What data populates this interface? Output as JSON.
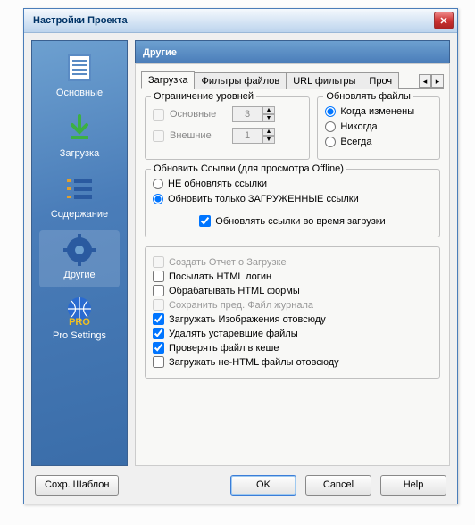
{
  "window": {
    "title": "Настройки Проекта",
    "close": "✕"
  },
  "sidebar": {
    "items": [
      {
        "label": "Основные"
      },
      {
        "label": "Загрузка"
      },
      {
        "label": "Содержание"
      },
      {
        "label": "Другие"
      },
      {
        "label": "Pro Settings"
      }
    ]
  },
  "main": {
    "header": "Другие",
    "tabs": [
      "Загрузка",
      "Фильтры файлов",
      "URL фильтры",
      "Проч"
    ],
    "tab_nav": {
      "prev": "◂",
      "next": "▸"
    }
  },
  "levels": {
    "legend": "Ограничение уровней",
    "row1_label": "Основные",
    "row1_value": "3",
    "row2_label": "Внешние",
    "row2_value": "1"
  },
  "update": {
    "legend": "Обновлять файлы",
    "opt1": "Когда изменены",
    "opt2": "Никогда",
    "opt3": "Всегда"
  },
  "links": {
    "legend": "Обновить Ссылки (для просмотра Offline)",
    "opt1": "НЕ обновлять ссылки",
    "opt2": "Обновить только ЗАГРУЖЕННЫЕ ссылки",
    "cb": "Обновлять ссылки во время загрузки"
  },
  "opts": {
    "o1": "Создать Отчет о Загрузке",
    "o2": "Посылать HTML логин",
    "o3": "Обрабатывать HTML формы",
    "o4": "Сохранить пред. Файл журнала",
    "o5": "Загружать Изображения отовсюду",
    "o6": "Удалять устаревшие файлы",
    "o7": "Проверять файл в кеше",
    "o8": "Загружать не-HTML файлы отовсюду"
  },
  "footer": {
    "save_tpl": "Сохр. Шаблон",
    "ok": "OK",
    "cancel": "Cancel",
    "help": "Help"
  }
}
